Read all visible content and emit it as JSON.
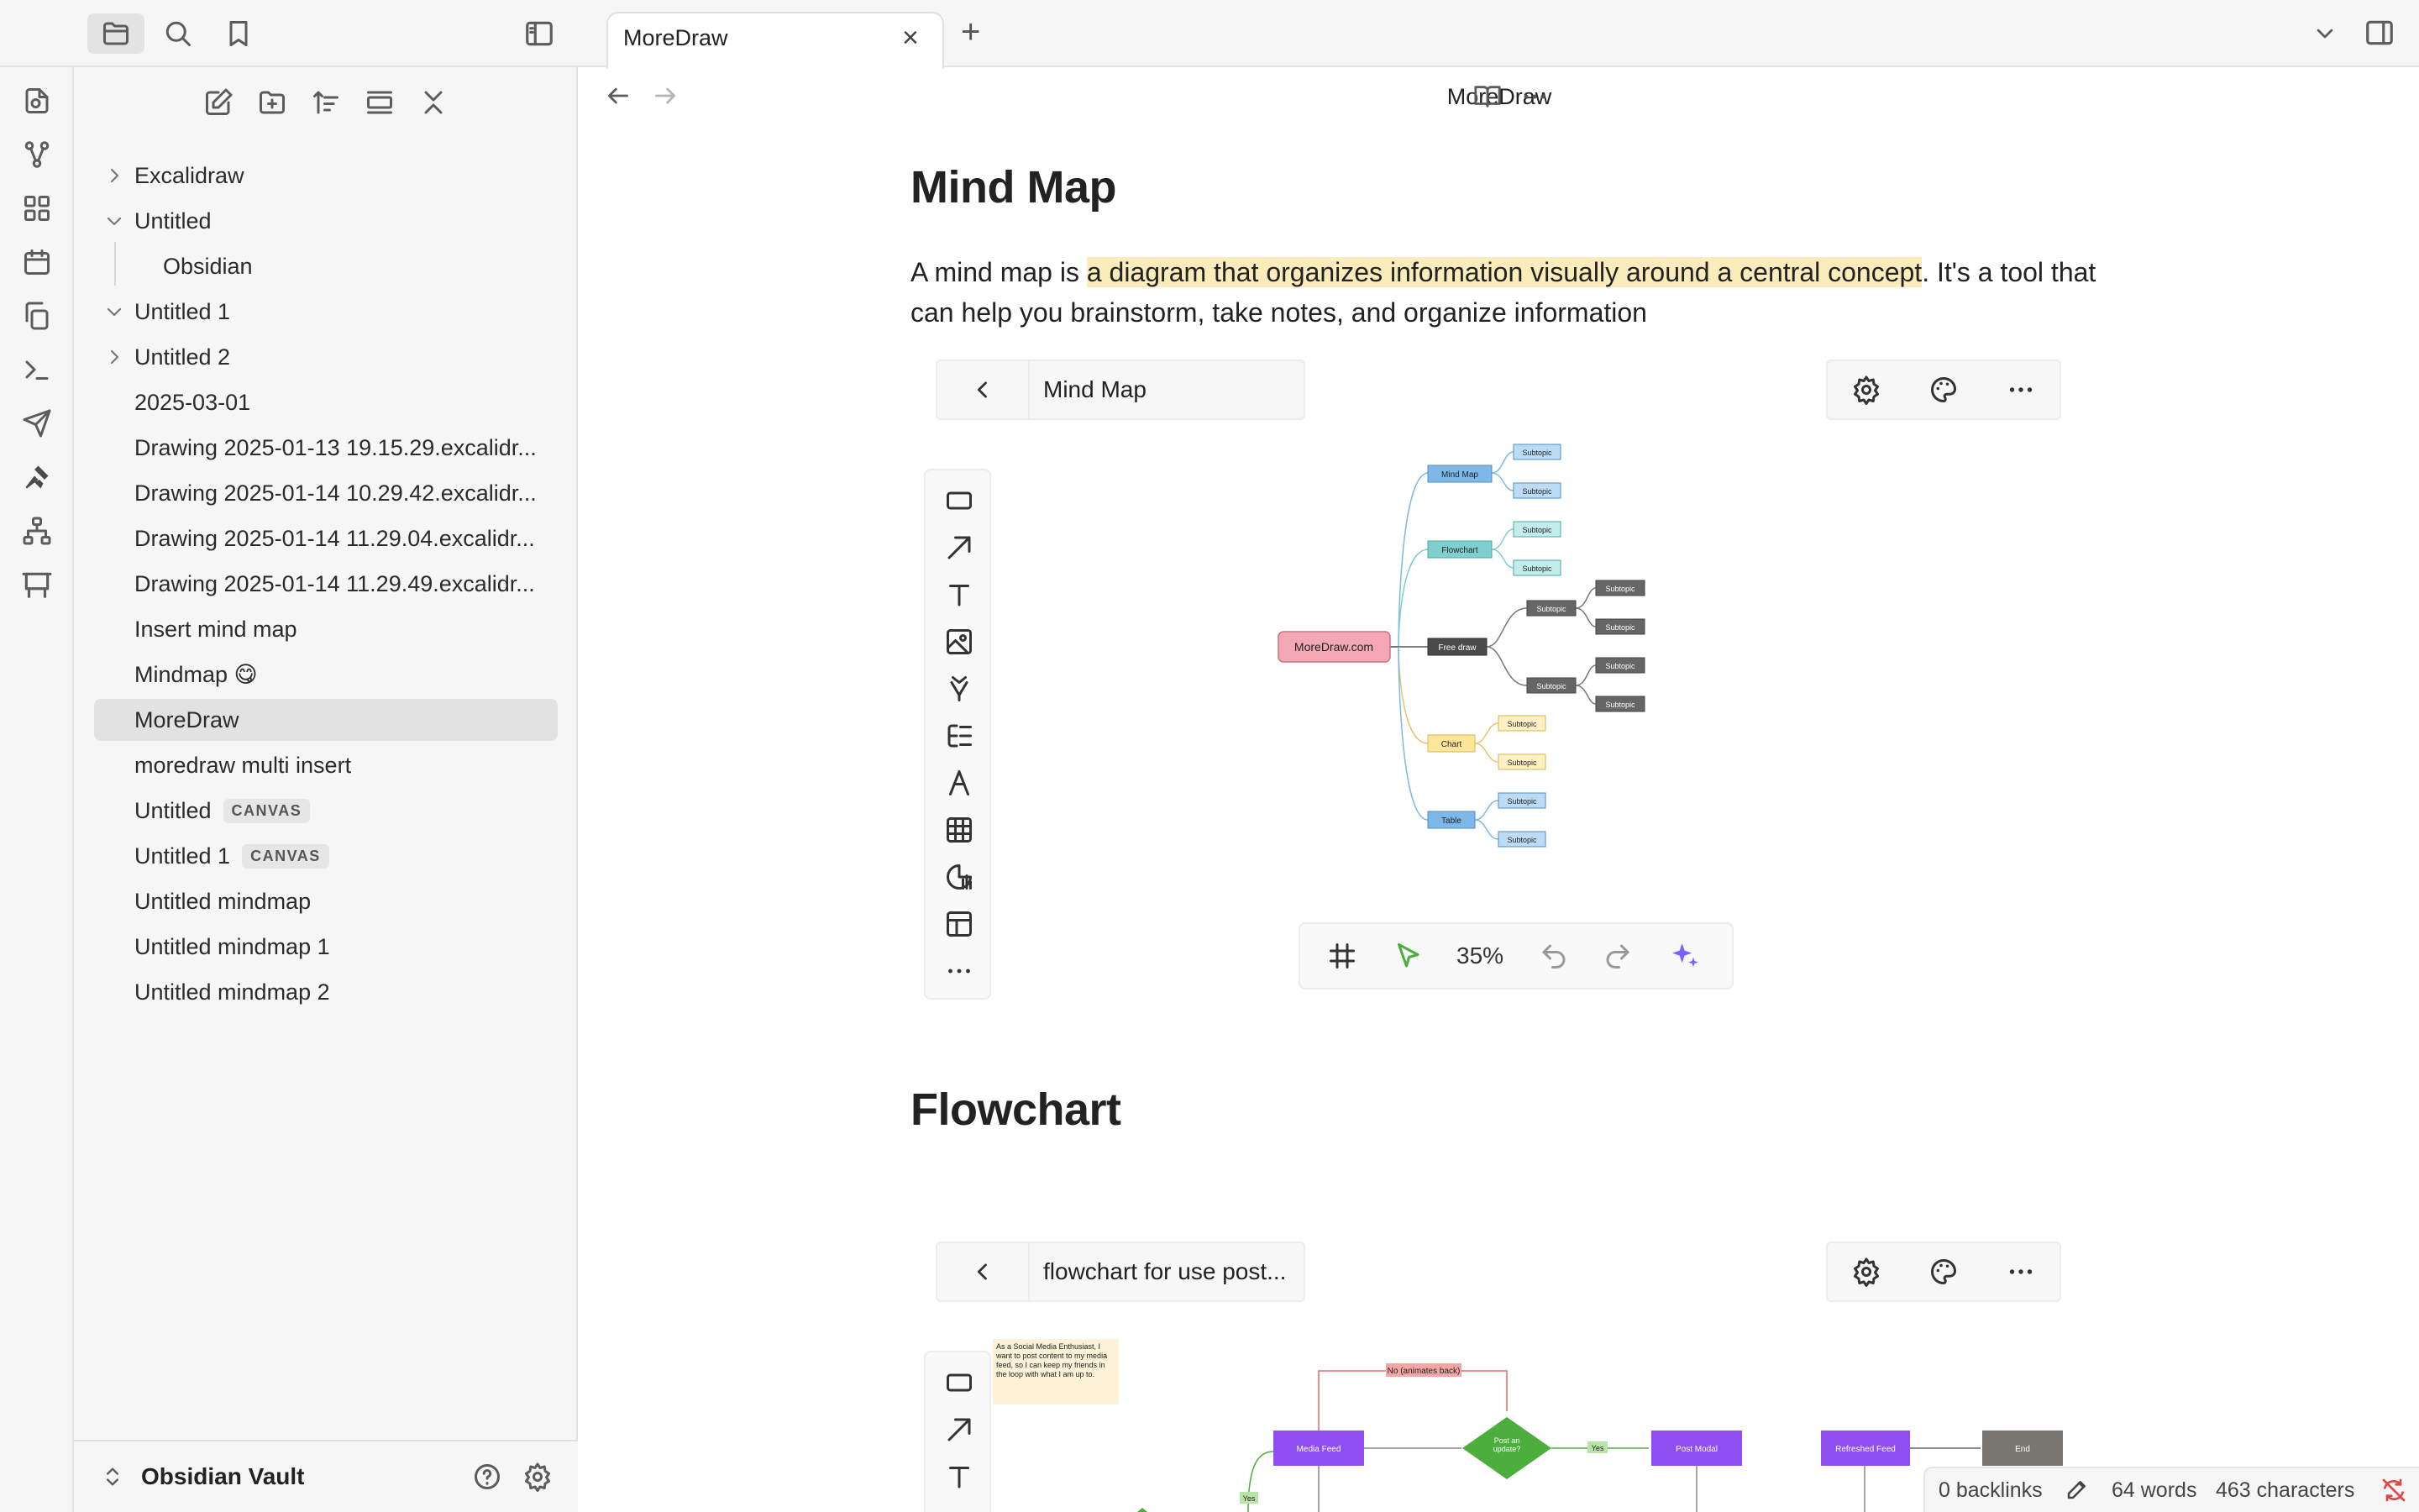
{
  "sidebar": {
    "vault_name": "Obsidian Vault",
    "items": [
      {
        "label": "Excalidraw",
        "chevron": "right"
      },
      {
        "label": "Untitled",
        "chevron": "down"
      },
      {
        "label": "Obsidian",
        "chevron": ""
      },
      {
        "label": "Untitled 1",
        "chevron": "down"
      },
      {
        "label": "Untitled 2",
        "chevron": "right"
      },
      {
        "label": "2025-03-01",
        "chevron": ""
      },
      {
        "label": "Drawing 2025-01-13 19.15.29.excalidr...",
        "chevron": ""
      },
      {
        "label": "Drawing 2025-01-14 10.29.42.excalidr...",
        "chevron": ""
      },
      {
        "label": "Drawing 2025-01-14 11.29.04.excalidr...",
        "chevron": ""
      },
      {
        "label": "Drawing 2025-01-14 11.29.49.excalidr...",
        "chevron": ""
      },
      {
        "label": "Insert mind map",
        "chevron": ""
      },
      {
        "label": "Mindmap 😋",
        "chevron": ""
      },
      {
        "label": "MoreDraw",
        "chevron": "",
        "active": true
      },
      {
        "label": "moredraw multi insert",
        "chevron": ""
      },
      {
        "label": "Untitled",
        "chevron": "",
        "badge": "CANVAS"
      },
      {
        "label": "Untitled 1",
        "chevron": "",
        "badge": "CANVAS"
      },
      {
        "label": "Untitled mindmap",
        "chevron": ""
      },
      {
        "label": "Untitled mindmap 1",
        "chevron": ""
      },
      {
        "label": "Untitled mindmap 2",
        "chevron": ""
      }
    ]
  },
  "tab": {
    "title": "MoreDraw",
    "close": "×",
    "new": "+"
  },
  "view": {
    "title": "MoreDraw"
  },
  "doc": {
    "h1": "Mind Map",
    "para_before": "A mind map is ",
    "para_highlight": "a diagram that organizes information visually around a central concept",
    "para_after": ". It's a tool that can help you brainstorm, take notes, and organize information",
    "h2": "Flowchart"
  },
  "embed1": {
    "title": "Mind Map",
    "zoom": "35%",
    "mindmap": {
      "root": "MoreDraw.com",
      "branch_mind": "Mind Map",
      "branch_flow": "Flowchart",
      "branch_free": "Free draw",
      "branch_chart": "Chart",
      "branch_table": "Table",
      "sub": "Subtopic"
    }
  },
  "embed2": {
    "title": "flowchart for use post...",
    "note": "As a Social Media Enthusiast, I want to post content to my media feed, so I can keep my friends in the loop with what I am up to.",
    "no_label": "No (animates back)",
    "media_feed": "Media Feed",
    "post_update": "Post an update?",
    "yes": "Yes",
    "post_modal": "Post Modal",
    "refreshed": "Refreshed Feed",
    "end": "End"
  },
  "status": {
    "backlinks": "0 backlinks",
    "words": "64 words",
    "chars": "463 characters"
  },
  "colors": {
    "accent": "#7b61ff",
    "highlight": "#fbecbb",
    "root_node": "#f4a7b5",
    "blue_node": "#7db8e8",
    "teal_node": "#7fcfcf",
    "dark_node": "#4a4a4a",
    "yellow_node": "#fde59a",
    "flow_purple": "#8e4ef0",
    "flow_green": "#4cae3c"
  }
}
